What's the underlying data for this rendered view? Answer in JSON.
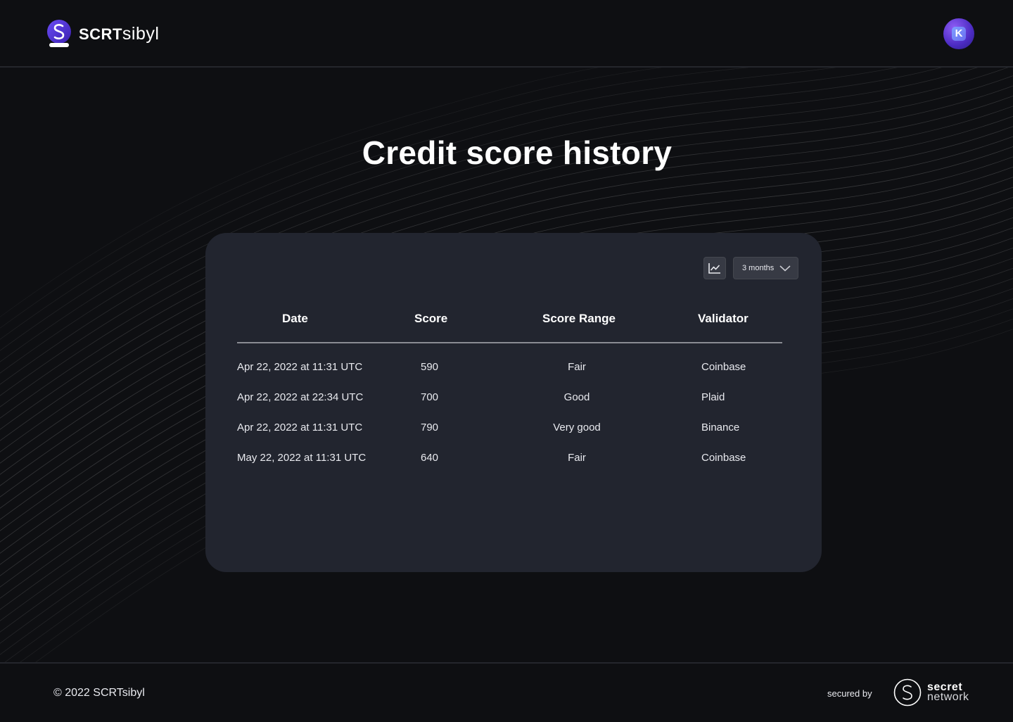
{
  "header": {
    "brand_bold": "SCRT",
    "brand_light": "sibyl",
    "avatar_initial": "K"
  },
  "page_title": "Credit score history",
  "controls": {
    "chart_icon": "line-chart-icon",
    "period_selected": "3 months"
  },
  "table": {
    "columns": [
      "Date",
      "Score",
      "Score Range",
      "Validator"
    ],
    "rows": [
      {
        "date": "Apr 22, 2022 at 11:31 UTC",
        "score": "590",
        "range": "Fair",
        "validator": "Coinbase"
      },
      {
        "date": "Apr 22, 2022 at 22:34 UTC",
        "score": "700",
        "range": "Good",
        "validator": "Plaid"
      },
      {
        "date": "Apr 22, 2022 at 11:31 UTC",
        "score": "790",
        "range": "Very good",
        "validator": "Binance"
      },
      {
        "date": "May 22, 2022 at 11:31 UTC",
        "score": "640",
        "range": "Fair",
        "validator": "Coinbase"
      }
    ]
  },
  "footer": {
    "copyright": "© 2022 SCRTsibyl",
    "secured_by": "secured by",
    "partner_line1": "secret",
    "partner_line2": "network"
  },
  "colors": {
    "background": "#0e0f12",
    "card": "#22252f",
    "accent_purple": "#5a3de0",
    "text": "#ffffff"
  }
}
